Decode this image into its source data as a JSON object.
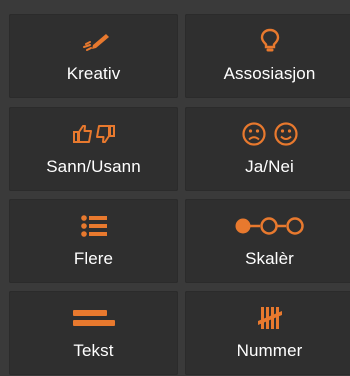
{
  "accent_color": "#e8792e",
  "background_color": "#3a3a3a",
  "tile_color": "#2f2f2f",
  "tiles": [
    {
      "label": "Kreativ",
      "icon": "pencil-icon"
    },
    {
      "label": "Assosiasjon",
      "icon": "lightbulb-icon"
    },
    {
      "label": "Sann/Usann",
      "icon": "thumbs-up-down-icon"
    },
    {
      "label": "Ja/Nei",
      "icon": "sad-happy-face-icon"
    },
    {
      "label": "Flere",
      "icon": "list-icon"
    },
    {
      "label": "Skalèr",
      "icon": "scale-slider-icon"
    },
    {
      "label": "Tekst",
      "icon": "text-lines-icon"
    },
    {
      "label": "Nummer",
      "icon": "tally-marks-icon"
    }
  ]
}
